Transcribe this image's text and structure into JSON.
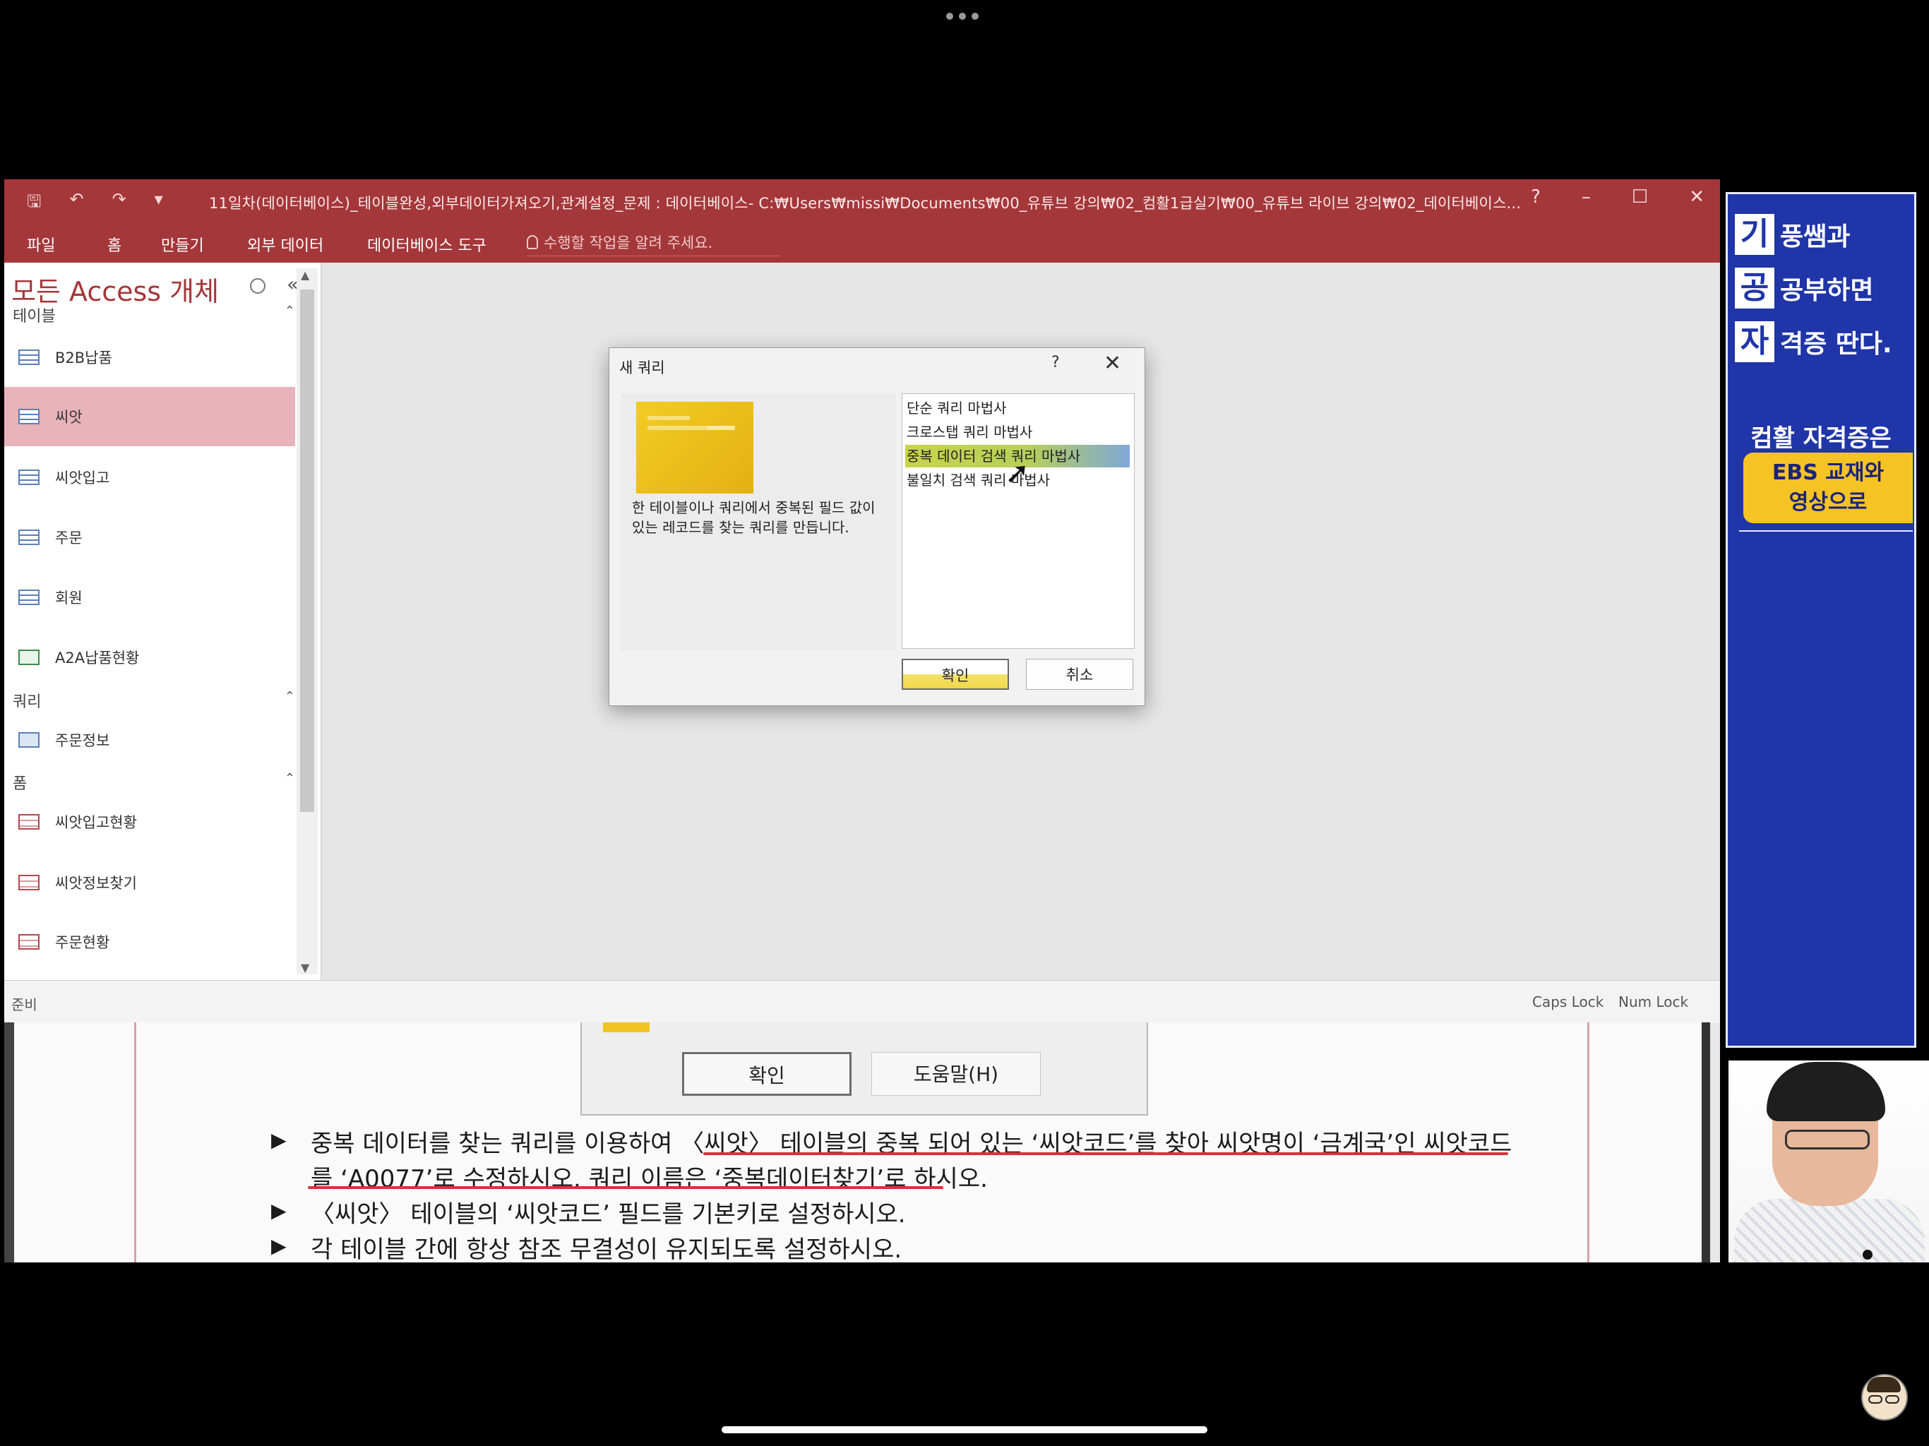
{
  "title_bar": {
    "document_title": "11일차(데이터베이스)_테이블완성,외부데이터가져오기,관계설정_문제 : 데이터베이스- C:₩Users₩missi₩Documents₩00_유튜브 강의₩02_컴활1급실기₩00_유튜브 라이브 강의₩02_데이터베이스...",
    "help": "?",
    "minimize": "–",
    "maximize": "☐",
    "close": "✕"
  },
  "ribbon": {
    "tabs": [
      "파일",
      "홈",
      "만들기",
      "외부 데이터",
      "데이터베이스 도구"
    ],
    "tell_me": "수행할 작업을 알려 주세요."
  },
  "nav_pane": {
    "title": "모든 Access 개체",
    "groups": {
      "tables": {
        "label": "테이블",
        "items": [
          "B2B납품",
          "씨앗",
          "씨앗입고",
          "주문",
          "회원",
          "A2A납품현황"
        ]
      },
      "queries": {
        "label": "쿼리",
        "items": [
          "주문정보"
        ]
      },
      "forms": {
        "label": "폼",
        "items": [
          "씨앗입고현황",
          "씨앗정보찾기",
          "주문현황"
        ]
      }
    }
  },
  "status_bar": {
    "left": "준비",
    "caps": "Caps Lock",
    "num": "Num Lock"
  },
  "dialog": {
    "title": "새 쿼리",
    "help": "?",
    "close": "✕",
    "description": "한 테이블이나 쿼리에서 중복된 필드 값이 있는 레코드를 찾는 쿼리를 만듭니다.",
    "options": [
      "단순 쿼리 마법사",
      "크로스탭 쿼리 마법사",
      "중복 데이터 검색 쿼리 마법사",
      "불일치 검색 쿼리 마법사"
    ],
    "selected_option": "중복 데이터 검색 쿼리 마법사",
    "ok": "확인",
    "cancel": "취소"
  },
  "textbook": {
    "dialog_ok": "확인",
    "dialog_help": "도움말(H)",
    "bullet": "▶",
    "line1": "중복 데이터를 찾는 쿼리를 이용하여 〈씨앗〉 테이블의 중복 되어 있는 ‘씨앗코드’를 찾아 씨앗명이 ‘금계국’인  씨앗코드",
    "line2": "를 ‘A0077’로 수정하시오. 쿼리 이름은 ‘중복데이터찾기’로 하시오.",
    "line3": "〈씨앗〉 테이블의 ‘씨앗코드’ 필드를 기본키로 설정하시오.",
    "line4": "각 테이블 간에 항상 참조 무결성이 유지되도록 설정하시오."
  },
  "banner": {
    "rows": [
      {
        "big": "기",
        "rest": "풍쌤과"
      },
      {
        "big": "공",
        "rest": "공부하면"
      },
      {
        "big": "자",
        "rest": "격증 딴다."
      }
    ],
    "sub": "컴활 자격증은",
    "highlight_line1": "EBS 교재와",
    "highlight_line2": "영상으로"
  }
}
